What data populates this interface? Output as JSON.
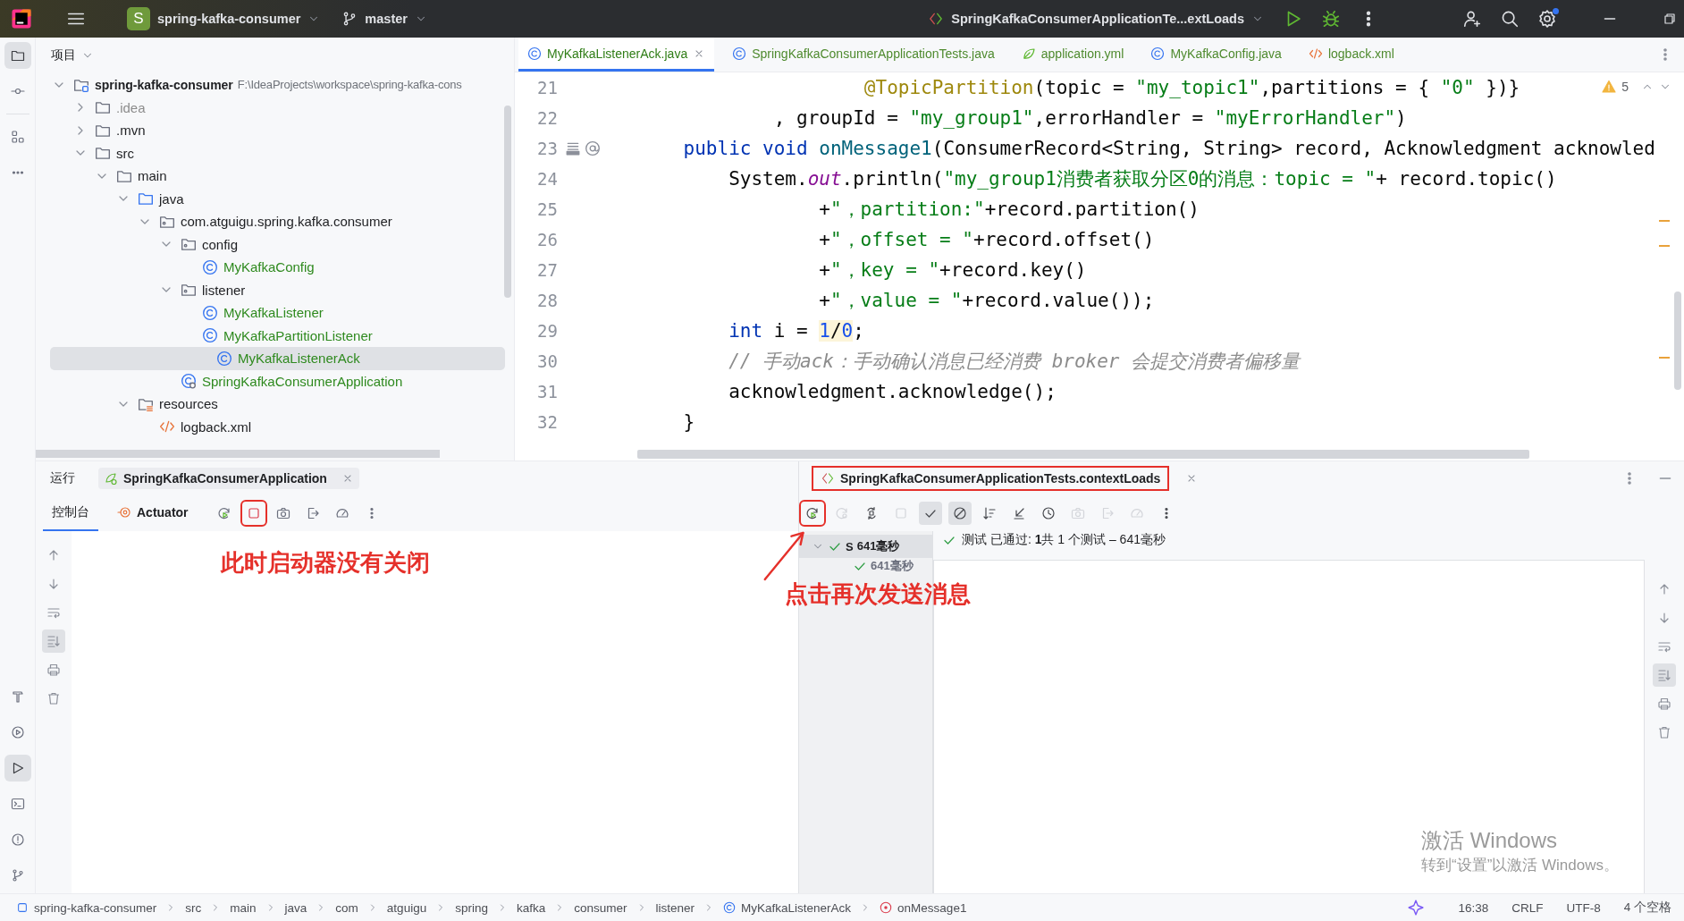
{
  "title_bar": {
    "project_badge": "S",
    "project": "spring-kafka-consumer",
    "branch": "master",
    "run_config": "SpringKafkaConsumerApplicationTe...extLoads",
    "settings_badge": true
  },
  "tool_strip": {
    "top": [
      {
        "kind": "folder",
        "selected": true
      },
      {
        "kind": "commit",
        "selected": false
      },
      {
        "kind": "structure",
        "selected": false
      },
      {
        "kind": "moreh",
        "selected": false
      }
    ],
    "bottom": [
      {
        "kind": "hammer",
        "selected": false
      },
      {
        "kind": "services",
        "selected": false
      },
      {
        "kind": "runwin",
        "selected": true
      },
      {
        "kind": "terminal",
        "selected": false
      },
      {
        "kind": "problems",
        "selected": false
      },
      {
        "kind": "branch",
        "selected": false
      }
    ]
  },
  "project_panel": {
    "title": "项目",
    "tree": [
      {
        "label": "spring-kafka-consumer",
        "path": "F:\\IdeaProjects\\workspace\\spring-kafka-cons",
        "kind": "module",
        "expanded": true,
        "selected": false,
        "children": [
          {
            "label": ".idea",
            "kind": "excluded",
            "expanded": false,
            "selected": false
          },
          {
            "label": ".mvn",
            "kind": "folder",
            "expanded": false,
            "selected": false
          },
          {
            "label": "src",
            "kind": "folder",
            "expanded": true,
            "selected": false,
            "children": [
              {
                "label": "main",
                "kind": "folder",
                "expanded": true,
                "selected": false,
                "children": [
                  {
                    "label": "java",
                    "kind": "source",
                    "expanded": true,
                    "selected": false,
                    "children": [
                      {
                        "label": "com.atguigu.spring.kafka.consumer",
                        "kind": "package",
                        "expanded": true,
                        "selected": false,
                        "children": [
                          {
                            "label": "config",
                            "kind": "package",
                            "expanded": true,
                            "selected": false,
                            "children": [
                              {
                                "label": "MyKafkaConfig",
                                "kind": "class",
                                "selected": false
                              }
                            ]
                          },
                          {
                            "label": "listener",
                            "kind": "package",
                            "expanded": true,
                            "selected": false,
                            "children": [
                              {
                                "label": "MyKafkaListener",
                                "kind": "class",
                                "selected": false
                              },
                              {
                                "label": "MyKafkaPartitionListener",
                                "kind": "class",
                                "selected": false
                              },
                              {
                                "label": "MyKafkaListenerAck",
                                "kind": "class",
                                "selected": true
                              }
                            ]
                          },
                          {
                            "label": "SpringKafkaConsumerApplication",
                            "kind": "app",
                            "selected": false
                          }
                        ]
                      }
                    ]
                  },
                  {
                    "label": "resources",
                    "kind": "resources",
                    "expanded": true,
                    "selected": false,
                    "children": [
                      {
                        "label": "logback.xml",
                        "kind": "xml",
                        "selected": false
                      }
                    ]
                  }
                ]
              }
            ]
          }
        ]
      }
    ]
  },
  "editor": {
    "tabs": [
      {
        "label": "MyKafkaListenerAck.java",
        "kind": "class",
        "selected": true
      },
      {
        "label": "SpringKafkaConsumerApplicationTests.java",
        "kind": "class",
        "selected": false
      },
      {
        "label": "application.yml",
        "kind": "yml",
        "selected": false
      },
      {
        "label": "MyKafkaConfig.java",
        "kind": "class",
        "selected": false
      },
      {
        "label": "logback.xml",
        "kind": "xml",
        "selected": false
      }
    ],
    "warnings": "5",
    "lines": [
      {
        "number": "21",
        "segments": [
          {
            "kind": "a",
            "text": "                    @TopicPartition"
          },
          {
            "kind": "p",
            "text": "(topic = "
          },
          {
            "kind": "s",
            "text": "\"my_topic1\""
          },
          {
            "kind": "p",
            "text": ",partitions = { "
          },
          {
            "kind": "s",
            "text": "\"0\""
          },
          {
            "kind": "p",
            "text": " })}"
          }
        ]
      },
      {
        "number": "22",
        "segments": [
          {
            "kind": "p",
            "text": "            , groupId = "
          },
          {
            "kind": "s",
            "text": "\"my_group1\""
          },
          {
            "kind": "p",
            "text": ",errorHandler = "
          },
          {
            "kind": "s",
            "text": "\"myErrorHandler\""
          },
          {
            "kind": "p",
            "text": ")"
          }
        ]
      },
      {
        "number": "23",
        "gutter": [
          {
            "kind": "stack"
          },
          {
            "kind": "at"
          }
        ],
        "segments": [
          {
            "kind": "k",
            "text": "    public void "
          },
          {
            "kind": "m",
            "text": "onMessage1"
          },
          {
            "kind": "p",
            "text": "(ConsumerRecord<String, String> record, Acknowledgment acknowled"
          }
        ]
      },
      {
        "number": "24",
        "segments": [
          {
            "kind": "p",
            "text": "        System."
          },
          {
            "kind": "f",
            "text": "out"
          },
          {
            "kind": "p",
            "text": ".println("
          },
          {
            "kind": "s",
            "text": "\"my_group1消费者获取分区0的消息：topic = \""
          },
          {
            "kind": "p",
            "text": "+ record.topic()"
          }
        ]
      },
      {
        "number": "25",
        "segments": [
          {
            "kind": "p",
            "text": "                +"
          },
          {
            "kind": "s",
            "text": "\"，partition:\""
          },
          {
            "kind": "p",
            "text": "+record.partition()"
          }
        ]
      },
      {
        "number": "26",
        "segments": [
          {
            "kind": "p",
            "text": "                +"
          },
          {
            "kind": "s",
            "text": "\"，offset = \""
          },
          {
            "kind": "p",
            "text": "+record.offset()"
          }
        ]
      },
      {
        "number": "27",
        "segments": [
          {
            "kind": "p",
            "text": "                +"
          },
          {
            "kind": "s",
            "text": "\"，key = \""
          },
          {
            "kind": "p",
            "text": "+record.key()"
          }
        ]
      },
      {
        "number": "28",
        "segments": [
          {
            "kind": "p",
            "text": "                +"
          },
          {
            "kind": "s",
            "text": "\"，value = \""
          },
          {
            "kind": "p",
            "text": "+record.value());"
          }
        ]
      },
      {
        "number": "29",
        "segments": [
          {
            "kind": "k",
            "text": "        int"
          },
          {
            "kind": "p",
            "text": " i = "
          },
          {
            "kind": "n",
            "text": "1",
            "highlight": true
          },
          {
            "kind": "p",
            "text": "/",
            "highlight": true
          },
          {
            "kind": "n",
            "text": "0",
            "highlight": true
          },
          {
            "kind": "p",
            "text": ";"
          }
        ]
      },
      {
        "number": "30",
        "segments": [
          {
            "kind": "c",
            "text": "        // 手动ack：手动确认消息已经消费 broker 会提交消费者偏移量"
          }
        ]
      },
      {
        "number": "31",
        "segments": [
          {
            "kind": "p",
            "text": "        acknowledgment.acknowledge();"
          }
        ]
      },
      {
        "number": "32",
        "segments": [
          {
            "kind": "p",
            "text": "    }"
          }
        ]
      }
    ]
  },
  "run_panel": {
    "title": "运行",
    "tab": {
      "label": "SpringKafkaConsumerApplication",
      "selected": true
    },
    "subtabs": [
      {
        "label": "控制台",
        "kind": "plain",
        "selected": true
      },
      {
        "label": "Actuator",
        "kind": "actuator",
        "selected": false
      }
    ],
    "toolbar": [
      {
        "kind": "rerun",
        "marked": false
      },
      {
        "kind": "stop",
        "marked": true
      },
      {
        "kind": "camera",
        "marked": false
      },
      {
        "kind": "exit",
        "marked": false
      },
      {
        "kind": "gauge",
        "marked": false
      },
      {
        "kind": "morev",
        "marked": false
      }
    ],
    "side_tools": [
      {
        "kind": "up",
        "selected": false
      },
      {
        "kind": "down",
        "selected": false
      },
      {
        "kind": "wrap",
        "selected": false
      },
      {
        "kind": "scrollend",
        "selected": true
      },
      {
        "kind": "print",
        "selected": false
      },
      {
        "kind": "trash",
        "selected": false
      }
    ]
  },
  "test_panel": {
    "tab": {
      "label": "SpringKafkaConsumerApplicationTests.contextLoads",
      "marked": true
    },
    "toolbar": [
      {
        "kind": "rerun",
        "marked": true,
        "disabled": false,
        "selected": false
      },
      {
        "kind": "rerunfail",
        "disabled": true,
        "selected": false
      },
      {
        "kind": "toggle",
        "disabled": false,
        "selected": false
      },
      {
        "kind": "stop",
        "disabled": true,
        "selected": false
      },
      {
        "kind": "check",
        "disabled": false,
        "selected": true
      },
      {
        "kind": "cancel",
        "disabled": false,
        "selected": true
      },
      {
        "kind": "sort",
        "disabled": false,
        "selected": false
      },
      {
        "kind": "collapse",
        "disabled": false,
        "selected": false
      },
      {
        "kind": "clock",
        "disabled": false,
        "selected": false
      },
      {
        "kind": "camera",
        "disabled": true,
        "selected": false
      },
      {
        "kind": "exit",
        "disabled": true,
        "selected": false
      },
      {
        "kind": "gauge",
        "disabled": true,
        "selected": false
      },
      {
        "kind": "morev",
        "disabled": false,
        "selected": false
      }
    ],
    "tree": [
      {
        "label": "S",
        "time": "641毫秒",
        "passed": true,
        "selected": true
      },
      {
        "time": "641毫秒",
        "passed": true,
        "selected": false
      }
    ],
    "status": "测试 已通过: **1**共 1 个测试 – 641毫秒",
    "side_tools": [
      {
        "kind": "up",
        "selected": false
      },
      {
        "kind": "down",
        "selected": false
      },
      {
        "kind": "wrap",
        "selected": false
      },
      {
        "kind": "scrollend",
        "selected": true
      },
      {
        "kind": "print",
        "selected": false
      },
      {
        "kind": "trash",
        "selected": false
      }
    ]
  },
  "annotations": [
    {
      "text": "此时启动器没有关闭"
    },
    {
      "text": "点击再次发送消息"
    }
  ],
  "activation_notice": {
    "title": "激活 Windows",
    "hint": "转到“设置”以激活 Windows。"
  },
  "status_bar": {
    "breadcrumbs": [
      {
        "label": "spring-kafka-consumer",
        "kind": "module"
      },
      {
        "label": "src",
        "kind": "plain"
      },
      {
        "label": "main",
        "kind": "plain"
      },
      {
        "label": "java",
        "kind": "plain"
      },
      {
        "label": "com",
        "kind": "plain"
      },
      {
        "label": "atguigu",
        "kind": "plain"
      },
      {
        "label": "spring",
        "kind": "plain"
      },
      {
        "label": "kafka",
        "kind": "plain"
      },
      {
        "label": "consumer",
        "kind": "plain"
      },
      {
        "label": "listener",
        "kind": "plain"
      },
      {
        "label": "MyKafkaListenerAck",
        "kind": "class"
      },
      {
        "label": "onMessage1",
        "kind": "method"
      }
    ],
    "items": [
      "16:38",
      "CRLF",
      "UTF-8",
      "4 个空格"
    ]
  }
}
